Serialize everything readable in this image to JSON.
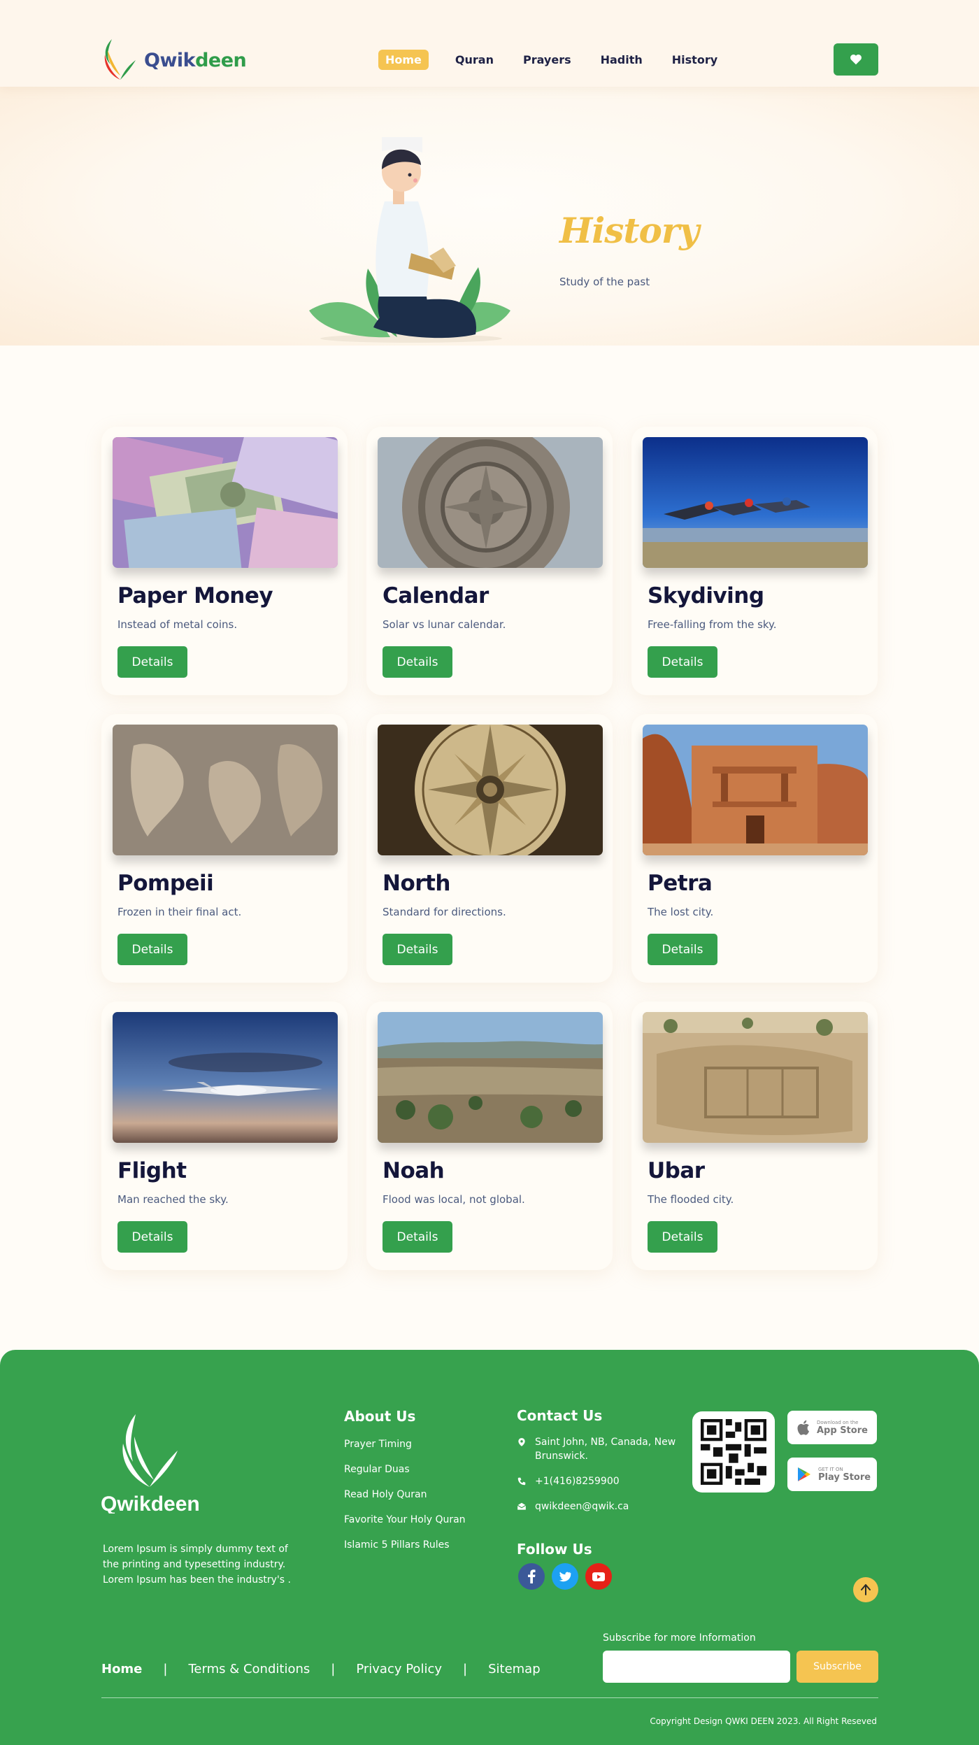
{
  "brand": {
    "name_part1": "Qwik",
    "name_part2": "deen"
  },
  "colors": {
    "green": "#34a04d",
    "yellow": "#f5c451",
    "navy": "#1e2145"
  },
  "nav": {
    "items": [
      {
        "label": "Home",
        "active": true
      },
      {
        "label": "Quran",
        "active": false
      },
      {
        "label": "Prayers",
        "active": false
      },
      {
        "label": "Hadith",
        "active": false
      },
      {
        "label": "History",
        "active": false
      }
    ],
    "favorite_icon": "heart-icon"
  },
  "hero": {
    "title": "History",
    "subtitle": "Study of the past"
  },
  "cards": [
    {
      "title": "Paper Money",
      "desc": "Instead of metal coins.",
      "button": "Details"
    },
    {
      "title": "Calendar",
      "desc": "Solar vs lunar calendar.",
      "button": "Details"
    },
    {
      "title": "Skydiving",
      "desc": "Free-falling from the sky.",
      "button": "Details"
    },
    {
      "title": "Pompeii",
      "desc": "Frozen in their final act.",
      "button": "Details"
    },
    {
      "title": "North",
      "desc": "Standard for directions.",
      "button": "Details"
    },
    {
      "title": "Petra",
      "desc": "The lost city.",
      "button": "Details"
    },
    {
      "title": "Flight",
      "desc": "Man reached the sky.",
      "button": "Details"
    },
    {
      "title": "Noah",
      "desc": "Flood was local, not global.",
      "button": "Details"
    },
    {
      "title": "Ubar",
      "desc": "The flooded city.",
      "button": "Details"
    }
  ],
  "footer": {
    "about_text": "Lorem Ipsum is simply dummy text of the printing and typesetting industry.  Lorem Ipsum has been the industry's .",
    "about_title": "About Us",
    "about_links": [
      "Prayer Timing",
      "Regular Duas",
      "Read Holy Quran",
      "Favorite Your Holy Quran",
      "Islamic 5 Pillars Rules"
    ],
    "contact_title": "Contact Us",
    "address": "Saint John, NB, Canada, New Brunswick.",
    "phone": "+1(416)8259900",
    "email": "qwikdeen@qwik.ca",
    "follow_title": "Follow Us",
    "app_store_small": "Download on the",
    "app_store_big": "App Store",
    "play_store_small": "GET IT ON",
    "play_store_big": "Play Store",
    "bottom_links": [
      "Home",
      "Terms & Conditions",
      "Privacy Policy",
      "Sitemap"
    ],
    "subscribe_label": "Subscribe for more Information",
    "subscribe_button": "Subscribe",
    "copyright": "Copyright Design QWKI DEEN 2023.  All Right Reseved"
  }
}
